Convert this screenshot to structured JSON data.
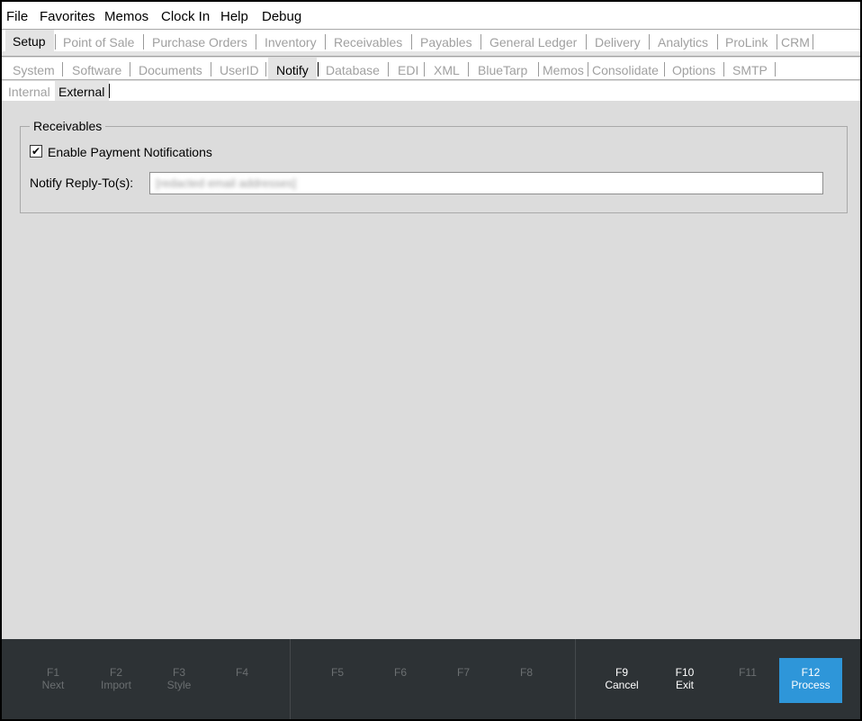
{
  "menu": [
    "File",
    "Favorites",
    "Memos",
    "Clock In",
    "Help",
    "Debug"
  ],
  "module_tabs": [
    {
      "label": "Setup",
      "active": true
    },
    {
      "label": "Point of Sale",
      "active": false
    },
    {
      "label": "Purchase Orders",
      "active": false
    },
    {
      "label": "Inventory",
      "active": false
    },
    {
      "label": "Receivables",
      "active": false
    },
    {
      "label": "Payables",
      "active": false
    },
    {
      "label": "General Ledger",
      "active": false
    },
    {
      "label": "Delivery",
      "active": false
    },
    {
      "label": "Analytics",
      "active": false
    },
    {
      "label": "ProLink",
      "active": false
    },
    {
      "label": "CRM",
      "active": false
    }
  ],
  "setup_tabs": [
    {
      "label": "System",
      "active": false
    },
    {
      "label": "Software",
      "active": false
    },
    {
      "label": "Documents",
      "active": false
    },
    {
      "label": "UserID",
      "active": false
    },
    {
      "label": "Notify",
      "active": true
    },
    {
      "label": "Database",
      "active": false
    },
    {
      "label": "EDI",
      "active": false
    },
    {
      "label": "XML",
      "active": false
    },
    {
      "label": "BlueTarp",
      "active": false
    },
    {
      "label": "Memos",
      "active": false
    },
    {
      "label": "Consolidate",
      "active": false
    },
    {
      "label": "Options",
      "active": false
    },
    {
      "label": "SMTP",
      "active": false
    }
  ],
  "notify_tabs": [
    {
      "label": "Internal",
      "active": false
    },
    {
      "label": "External",
      "active": true
    }
  ],
  "receivables": {
    "group_label": "Receivables",
    "enable_payment_notifications": {
      "label": "Enable Payment Notifications",
      "checked": true,
      "check_glyph": "✔"
    },
    "reply_to_label": "Notify Reply-To(s):",
    "reply_to_value": "[redacted email addresses]"
  },
  "function_keys": [
    {
      "key": "F1",
      "action": "Next",
      "enabled": false
    },
    {
      "key": "F2",
      "action": "Import",
      "enabled": false
    },
    {
      "key": "F3",
      "action": "Style",
      "enabled": false
    },
    {
      "key": "F4",
      "action": "",
      "enabled": false
    },
    {
      "key": "F5",
      "action": "",
      "enabled": false
    },
    {
      "key": "F6",
      "action": "",
      "enabled": false
    },
    {
      "key": "F7",
      "action": "",
      "enabled": false
    },
    {
      "key": "F8",
      "action": "",
      "enabled": false
    },
    {
      "key": "F9",
      "action": "Cancel",
      "enabled": true
    },
    {
      "key": "F10",
      "action": "Exit",
      "enabled": true
    },
    {
      "key": "F11",
      "action": "",
      "enabled": false
    },
    {
      "key": "F12",
      "action": "Process",
      "enabled": true,
      "primary": true
    }
  ],
  "colors": {
    "primary_button": "#2e96d9",
    "footer_bg": "#2d3235",
    "panel_bg": "#dcdcdc"
  }
}
